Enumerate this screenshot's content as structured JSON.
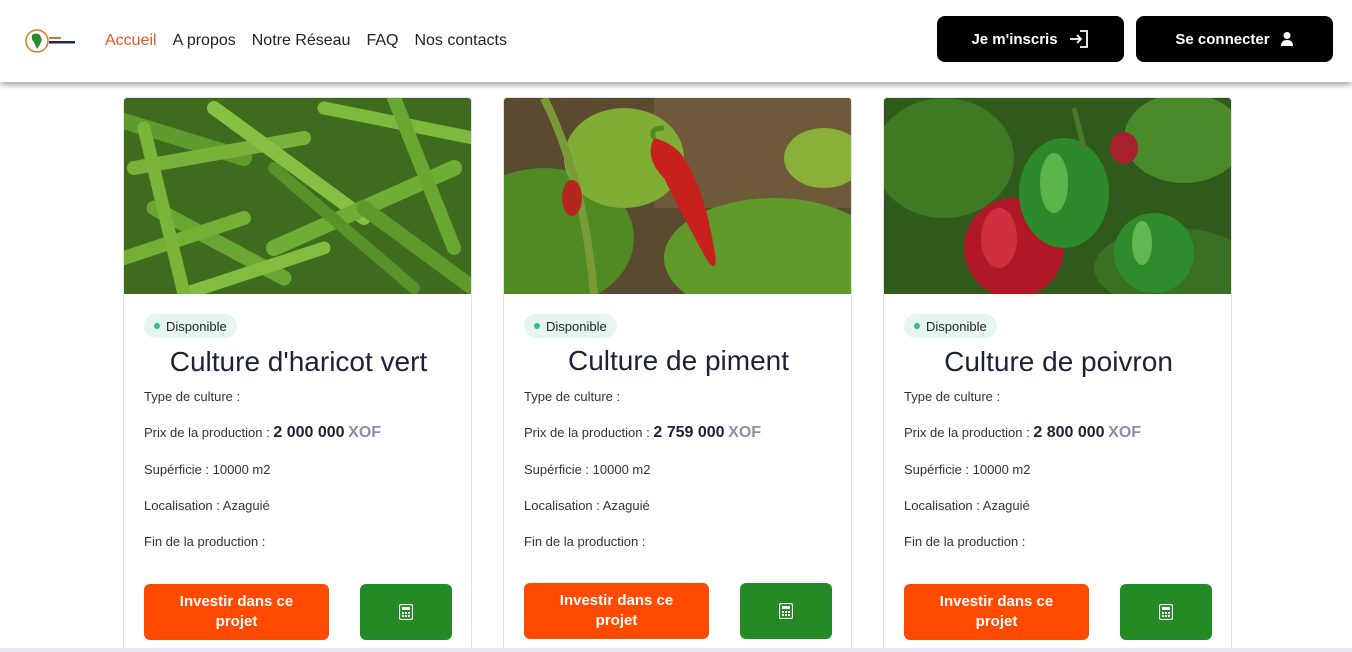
{
  "nav": {
    "links": [
      "Accueil",
      "A propos",
      "Notre Réseau",
      "FAQ",
      "Nos contacts"
    ],
    "active": "Accueil",
    "register_label": "Je m'inscris",
    "login_label": "Se connecter"
  },
  "cards": [
    {
      "image": "green-beans-photo",
      "status": "Disponible",
      "title": "Culture d'haricot vert",
      "type_label": "Type de culture :",
      "price_label": "Prix de la production :",
      "price_value": "2 000 000",
      "price_currency": "XOF",
      "area": "Supérficie : 10000 m2",
      "location": "Localisation : Azaguié",
      "end": "Fin de la production :",
      "invest_label": "Investir dans ce projet"
    },
    {
      "image": "chili-pepper-photo",
      "status": "Disponible",
      "title": "Culture de piment",
      "type_label": "Type de culture :",
      "price_label": "Prix de la production :",
      "price_value": "2 759 000",
      "price_currency": "XOF",
      "area": "Supérficie : 10000 m2",
      "location": "Localisation : Azaguié",
      "end": "Fin de la production :",
      "invest_label": "Investir dans ce projet"
    },
    {
      "image": "bell-pepper-photo",
      "status": "Disponible",
      "title": "Culture de poivron",
      "type_label": "Type de culture :",
      "price_label": "Prix de la production :",
      "price_value": "2 800 000",
      "price_currency": "XOF",
      "area": "Supérficie : 10000 m2",
      "location": "Localisation : Azaguié",
      "end": "Fin de la production :",
      "invest_label": "Investir dans ce projet"
    }
  ],
  "colors": {
    "accent": "#f0521f",
    "invest": "#ff4a00",
    "calc": "#248a25",
    "badge_bg": "#e6f5f1",
    "badge_dot": "#2fbf8f"
  }
}
